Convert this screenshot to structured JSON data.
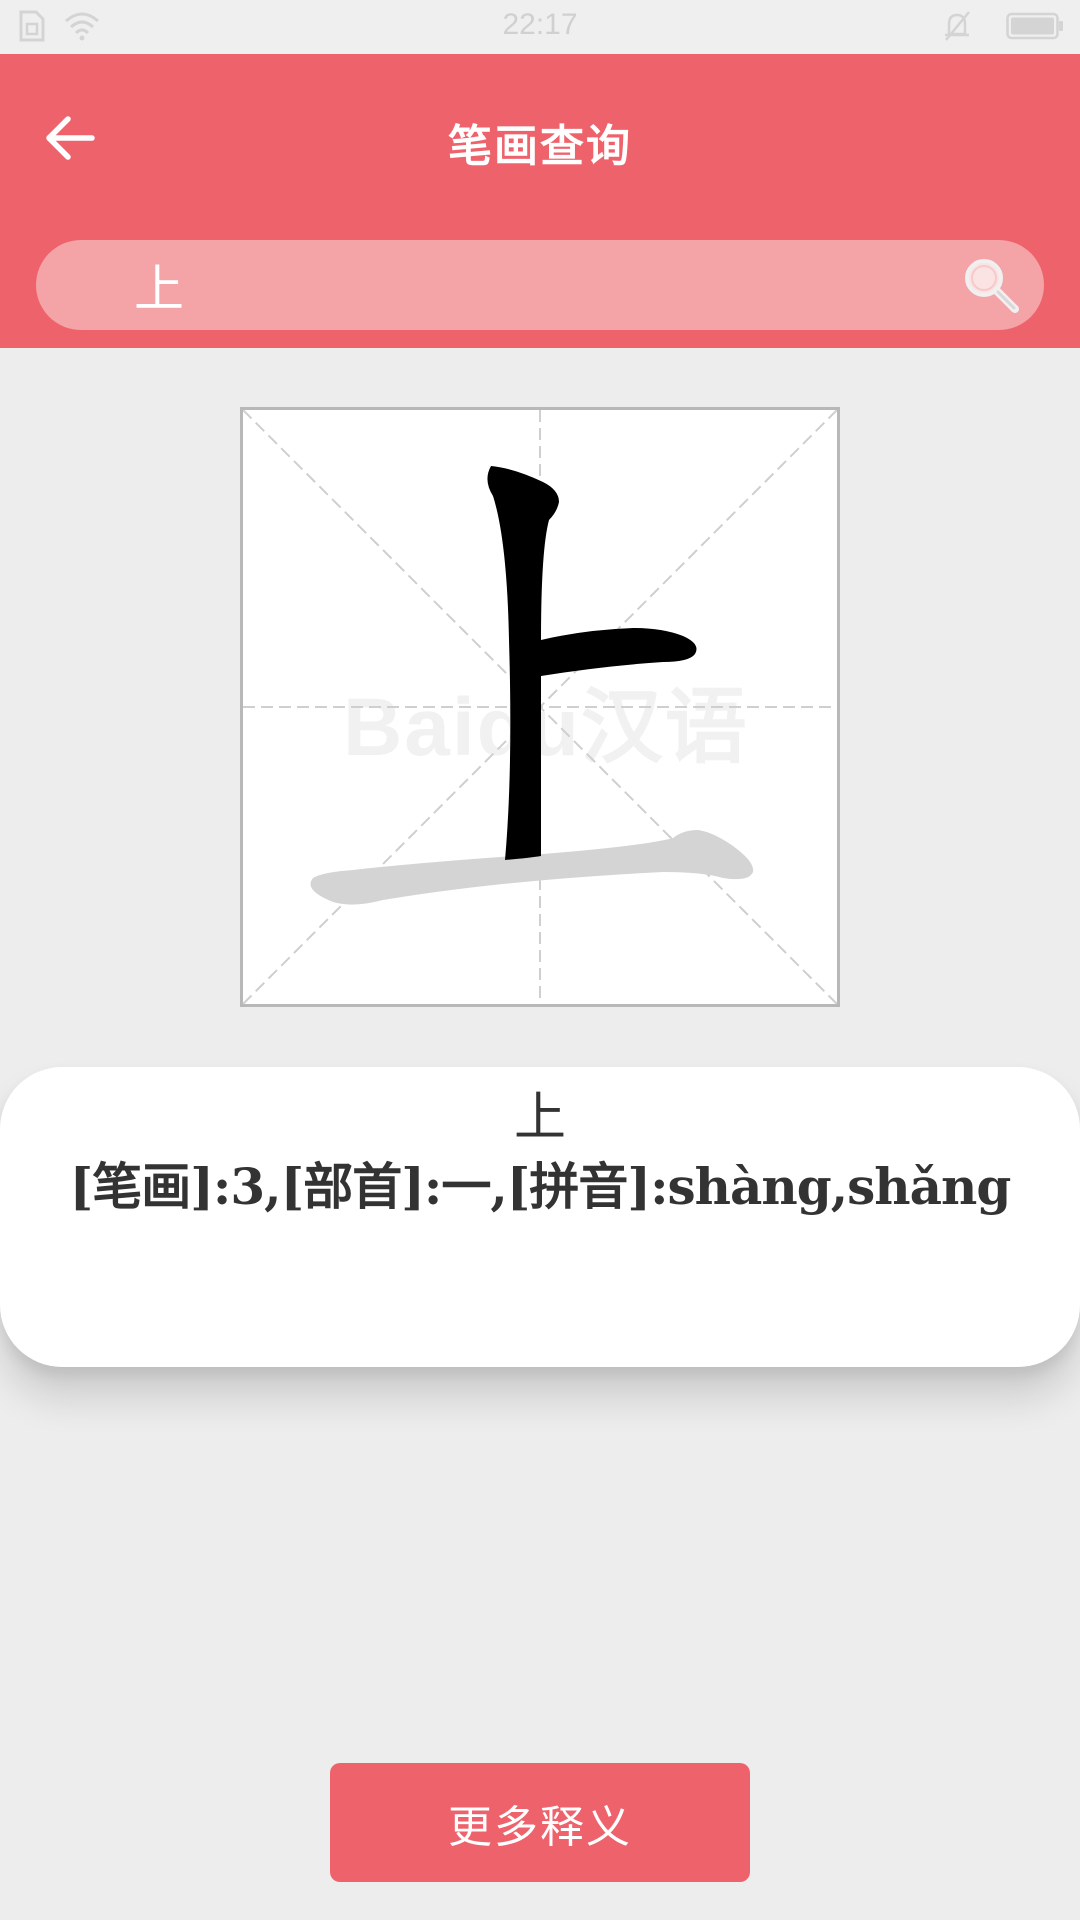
{
  "status_bar": {
    "time": "22:17",
    "icons": [
      "sim-icon",
      "wifi-icon",
      "mute-bell-icon",
      "battery-icon"
    ]
  },
  "header": {
    "title": "笔画查询",
    "back_icon": "arrow-left-icon",
    "background_color": "#ee626c"
  },
  "search": {
    "value": "上",
    "icon": "search-icon"
  },
  "stroke_grid": {
    "character": "上",
    "watermark": "Baidu汉语"
  },
  "info": {
    "character": "上",
    "detail": "[笔画]:3,[部首]:一,[拼音]:shàng,shǎng"
  },
  "more_button": {
    "label": "更多释义",
    "color": "#ee626c"
  }
}
